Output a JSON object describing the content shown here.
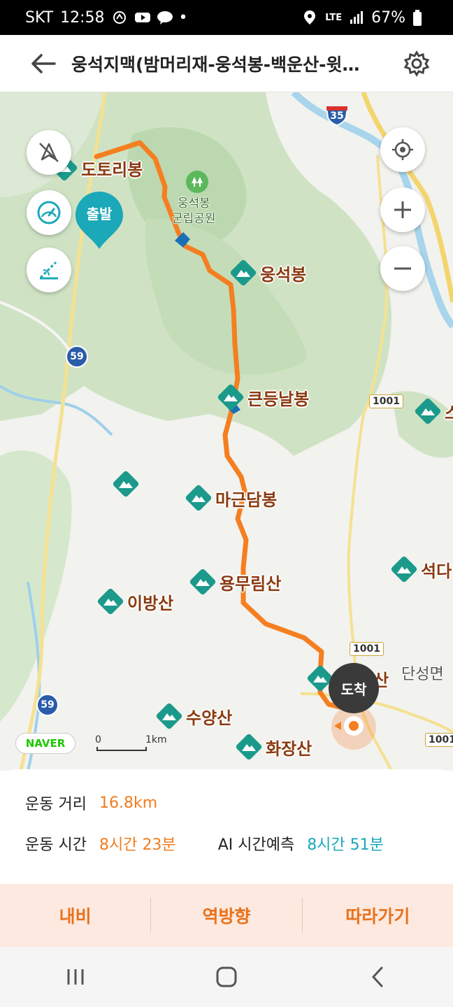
{
  "status_bar": {
    "carrier": "SKT",
    "time": "12:58",
    "dot": "•",
    "network": "LTE",
    "battery": "67%"
  },
  "app_bar": {
    "title": "웅석지맥(밤머리재-웅석봉-백운산-윗…"
  },
  "map": {
    "start_label": "출발",
    "end_label": "도착",
    "pois": [
      {
        "name": "도토리봉"
      },
      {
        "name": "웅석봉"
      },
      {
        "name": "큰등날봉"
      },
      {
        "name": "마근담봉"
      },
      {
        "name": "용무림산"
      },
      {
        "name": "이방산"
      },
      {
        "name": "수양산"
      },
      {
        "name": "화장산"
      },
      {
        "name": "산"
      },
      {
        "name": "석다"
      },
      {
        "name": "스"
      }
    ],
    "park_label_1": "웅석봉",
    "park_label_2": "군립공원",
    "region_label": "단성면",
    "road_badges": [
      "35",
      "59",
      "59",
      "1001",
      "1001",
      "1001"
    ],
    "naver_logo": "NAVER",
    "scale_zero": "0",
    "scale_km": "1km"
  },
  "stats": {
    "distance_label": "운동 거리",
    "distance_value": "16.8km",
    "time_label": "운동 시간",
    "time_value": "8시간 23분",
    "ai_label": "AI 시간예측",
    "ai_value": "8시간 51분"
  },
  "actions": [
    {
      "label": "내비"
    },
    {
      "label": "역방향"
    },
    {
      "label": "따라가기"
    }
  ],
  "colors": {
    "route": "#f57f20",
    "accent_teal": "#1ba8b8",
    "action_bg": "#fde9df",
    "action_text": "#e8721d",
    "map_green": "#cfe3c4"
  }
}
